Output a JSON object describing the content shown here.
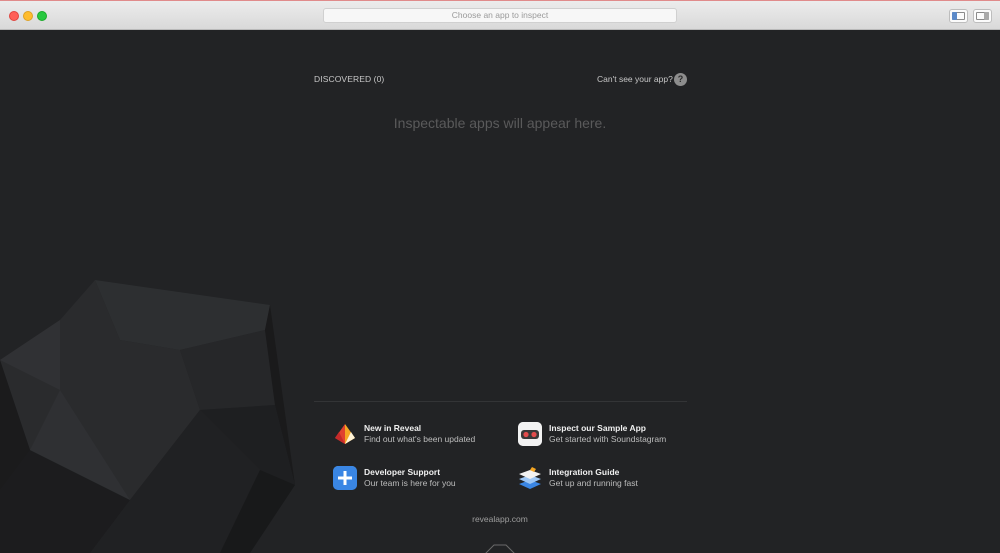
{
  "window": {
    "address_placeholder": "Choose an app to inspect"
  },
  "discovered": {
    "label": "DISCOVERED (0)",
    "help_text": "Can't see your app?",
    "help_icon": "question-mark-icon",
    "empty_message": "Inspectable apps will appear here."
  },
  "links": [
    {
      "title": "New in Reveal",
      "subtitle": "Find out what's been updated",
      "icon": "reveal-logo-icon"
    },
    {
      "title": "Inspect our Sample App",
      "subtitle": "Get started with Soundstagram",
      "icon": "sample-app-icon"
    },
    {
      "title": "Developer Support",
      "subtitle": "Our team is here for you",
      "icon": "plus-icon"
    },
    {
      "title": "Integration Guide",
      "subtitle": "Get up and running fast",
      "icon": "layers-icon"
    }
  ],
  "footer": {
    "website": "revealapp.com",
    "badge_icon": "itty-bitty-apps-logo"
  },
  "colors": {
    "background": "#222325",
    "accent_blue": "#3a86e4",
    "reveal_orange": "#f08a2a",
    "sample_red": "#e34d4d"
  }
}
